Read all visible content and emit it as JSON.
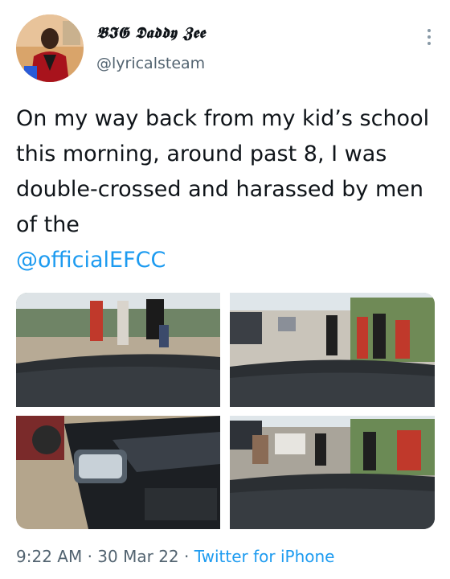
{
  "user": {
    "display_name": "𝕭𝕴𝕲 𝕯𝖆𝖉𝖉𝖞 𝖅𝖊𝖊",
    "handle": "@lyricalsteam"
  },
  "tweet": {
    "text": "On my way back from my kid’s school this morning, around past 8, I was double-crossed and harassed by men of the",
    "mention": "@officialEFCC"
  },
  "meta": {
    "time": "9:22 AM",
    "separator": " · ",
    "date": "30 Mar 22",
    "source": "Twitter for iPhone"
  },
  "icons": {
    "more": "more-vertical-icon"
  },
  "colors": {
    "link": "#1d9bf0",
    "secondary_text": "#536471"
  }
}
